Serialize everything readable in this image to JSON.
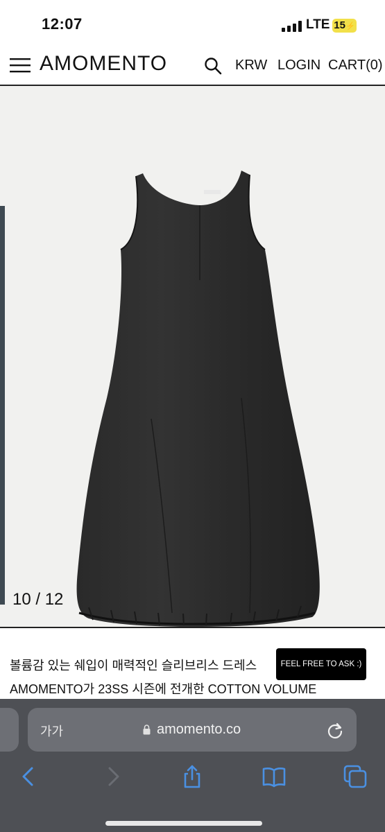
{
  "status_bar": {
    "time": "12:07",
    "network": "LTE",
    "battery": "15",
    "battery_color": "#f2e04a"
  },
  "header": {
    "brand": "AMOMENTO",
    "icons": [
      "menu-icon",
      "search-icon"
    ],
    "nav": {
      "currency": "KRW",
      "login": "LOGIN",
      "cart": "CART(0)"
    }
  },
  "gallery": {
    "counter": "10 / 12",
    "image": "black-sleeveless-bubble-dress",
    "background_color": "#f1f1ef"
  },
  "description": {
    "line1": "볼륨감 있는 쉐입이 매력적인 슬리브리스 드레스",
    "line2": "AMOMENTO가 23SS 시즌에 전개한 COTTON VOLUME"
  },
  "chat_button": {
    "label": "FEEL FREE TO ASK :)"
  },
  "browser": {
    "text_size_label": "가가",
    "url": "amomento.co",
    "bar_color": "#4e5055",
    "accent_color": "#4a90e2",
    "toolbar_icons": [
      "back-icon",
      "forward-icon",
      "share-icon",
      "bookmarks-icon",
      "tabs-icon"
    ]
  }
}
